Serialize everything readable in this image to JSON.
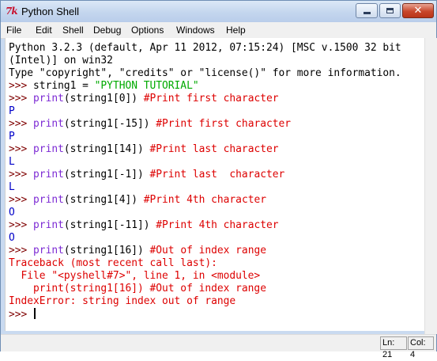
{
  "window": {
    "title": "Python Shell",
    "icon_glyph": "7k",
    "controls": {
      "minimize": "",
      "maximize": "",
      "close": "✕"
    }
  },
  "menu": [
    "File",
    "Edit",
    "Shell",
    "Debug",
    "Options",
    "Windows",
    "Help"
  ],
  "console": {
    "banner": [
      "Python 3.2.3 (default, Apr 11 2012, 07:15:24) [MSC v.1500 32 bit",
      "(Intel)] on win32",
      "Type \"copyright\", \"credits\" or \"license()\" for more information."
    ],
    "prompt": ">>> ",
    "entries": [
      {
        "before": "string1 = ",
        "str": "\"PYTHON TUTORIAL\""
      },
      {
        "kw": "print",
        "args": "(string1[0]) ",
        "comment": "#Print first character",
        "result": "P"
      },
      {
        "kw": "print",
        "args": "(string1[-15]) ",
        "comment": "#Print first character",
        "result": "P"
      },
      {
        "kw": "print",
        "args": "(string1[14]) ",
        "comment": "#Print last character",
        "result": "L"
      },
      {
        "kw": "print",
        "args": "(string1[-1]) ",
        "comment": "#Print last  character",
        "result": "L"
      },
      {
        "kw": "print",
        "args": "(string1[4]) ",
        "comment": "#Print 4th character",
        "result": "O"
      },
      {
        "kw": "print",
        "args": "(string1[-11]) ",
        "comment": "#Print 4th character",
        "result": "O"
      },
      {
        "kw": "print",
        "args": "(string1[16]) ",
        "comment": "#Out of index range"
      }
    ],
    "traceback": [
      "Traceback (most recent call last):",
      "  File \"<pyshell#7>\", line 1, in <module>",
      "    print(string1[16]) #Out of index range",
      "IndexError: string index out of range"
    ]
  },
  "status": {
    "line": "Ln: 21",
    "col": "Col: 4"
  },
  "colors": {
    "prompt": "#7f0000",
    "keyword": "#7d2bd4",
    "string": "#00aa00",
    "comment": "#dd0000",
    "output": "#0000c8",
    "error": "#dd0000"
  }
}
